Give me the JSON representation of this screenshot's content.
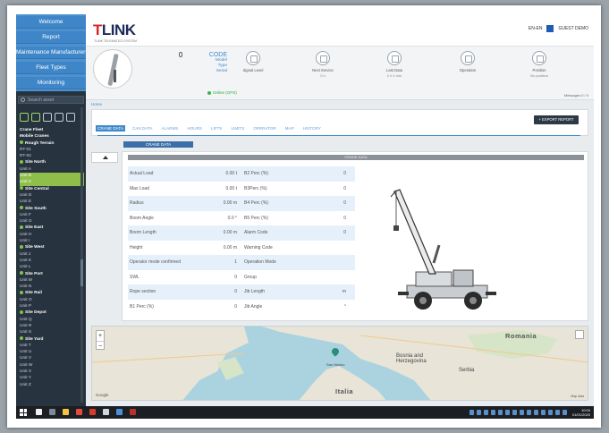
{
  "sidebar": {
    "nav": [
      "Welcome",
      "Report",
      "Maintenance Manufacturers",
      "Fleet Types",
      "Monitoring"
    ],
    "search_placeholder": "Search asset",
    "tree": [
      {
        "label": "Crane Fleet",
        "type": "grp"
      },
      {
        "label": "Mobile Cranes",
        "type": "grp"
      },
      {
        "label": "Rough Terrain",
        "type": "dot"
      },
      {
        "label": "RT-01",
        "type": "item"
      },
      {
        "label": "RT-02",
        "type": "item"
      },
      {
        "label": "Site North",
        "type": "dot"
      },
      {
        "label": "Unit A",
        "type": "item"
      },
      {
        "label": "Unit B",
        "type": "sel"
      },
      {
        "label": "Unit C",
        "type": "sel"
      },
      {
        "label": "Site Central",
        "type": "dot"
      },
      {
        "label": "Unit D",
        "type": "item"
      },
      {
        "label": "Unit E",
        "type": "item"
      },
      {
        "label": "Site South",
        "type": "dot"
      },
      {
        "label": "Unit F",
        "type": "item"
      },
      {
        "label": "Unit G",
        "type": "item"
      },
      {
        "label": "Site East",
        "type": "dot"
      },
      {
        "label": "Unit H",
        "type": "item"
      },
      {
        "label": "Unit I",
        "type": "item"
      },
      {
        "label": "Site West",
        "type": "dot"
      },
      {
        "label": "Unit J",
        "type": "item"
      },
      {
        "label": "Unit K",
        "type": "item"
      },
      {
        "label": "Unit L",
        "type": "item"
      },
      {
        "label": "Site Port",
        "type": "dot"
      },
      {
        "label": "Unit M",
        "type": "item"
      },
      {
        "label": "Unit N",
        "type": "item"
      },
      {
        "label": "Site Rail",
        "type": "dot"
      },
      {
        "label": "Unit O",
        "type": "item"
      },
      {
        "label": "Unit P",
        "type": "item"
      },
      {
        "label": "Site Depot",
        "type": "dot"
      },
      {
        "label": "Unit Q",
        "type": "item"
      },
      {
        "label": "Unit R",
        "type": "item"
      },
      {
        "label": "Unit S",
        "type": "item"
      },
      {
        "label": "Site Yard",
        "type": "dot"
      },
      {
        "label": "Unit T",
        "type": "item"
      },
      {
        "label": "Unit U",
        "type": "item"
      },
      {
        "label": "Unit V",
        "type": "item"
      },
      {
        "label": "Unit W",
        "type": "item"
      },
      {
        "label": "Unit X",
        "type": "item"
      },
      {
        "label": "Unit Y",
        "type": "item"
      },
      {
        "label": "Unit Z",
        "type": "item"
      }
    ]
  },
  "header": {
    "logo_t": "T",
    "logo_rest": "LINK",
    "logo_sub": "TLINK TELEMATICS SYSTEM",
    "user_lang": "EN-EN",
    "user_name": "GUEST DEMO"
  },
  "asset": {
    "code": "CODE",
    "lines": [
      "Model",
      "Type",
      "Serial"
    ],
    "status": "Online (GPS)"
  },
  "kpis": [
    {
      "label": "Signal Level",
      "value": ""
    },
    {
      "label": "Next Service",
      "value": "0 h"
    },
    {
      "label": "Last Data",
      "value": "0 h 0 min"
    },
    {
      "label": "Operation",
      "value": ""
    },
    {
      "label": "Position",
      "value": "No position"
    }
  ],
  "band_footer": "Messages 0 / 0",
  "content": {
    "breadcrumb": "Home",
    "tabs": [
      "CRANE DATA",
      "CAN DATA",
      "ALARMS",
      "HOURS",
      "LIFTS",
      "LIMITS",
      "OPERATOR",
      "MAP",
      "HISTORY"
    ],
    "export_button": "+ EXPORT REPORT",
    "title_pill": "CRANE DATA",
    "card_header": "CRANE DATA"
  },
  "grid_rows": [
    {
      "l1": "Actual Load",
      "v1": "0.00 t",
      "l2": "B2 Perc (%)",
      "v2": "0"
    },
    {
      "l1": "Max Load",
      "v1": "0.00 t",
      "l2": "B3Perc (%)",
      "v2": "0"
    },
    {
      "l1": "Radius",
      "v1": "0.00 m",
      "l2": "B4 Perc (%)",
      "v2": "0"
    },
    {
      "l1": "Boom Angle",
      "v1": "0.0 °",
      "l2": "B5 Perc (%)",
      "v2": "0"
    },
    {
      "l1": "Boom Length",
      "v1": "0.00 m",
      "l2": "Alarm Code",
      "v2": "0"
    },
    {
      "l1": "Height",
      "v1": "0.00 m",
      "l2": "Warning Code",
      "v2": ""
    },
    {
      "l1": "Operator mode confirmed",
      "v1": "1",
      "l2": "Operation Mode",
      "v2": ""
    },
    {
      "l1": "SWL",
      "v1": "0",
      "l2": "Group",
      "v2": ""
    },
    {
      "l1": "Rope section",
      "v1": "0",
      "l2": "Jib Length",
      "v2": "m"
    },
    {
      "l1": "B1 Perc (%)",
      "v1": "0",
      "l2": "Jib Angle",
      "v2": "°"
    }
  ],
  "map": {
    "zoom_in": "+",
    "zoom_out": "−",
    "labels": [
      "Romania",
      "Bosnia and Herzegovina",
      "Serbia",
      "Italia",
      "San Marino"
    ],
    "google": "Google",
    "attribution": "Map data"
  },
  "taskbar": {
    "time": "10:00",
    "date": "01/01/2020"
  },
  "colors": {
    "accent": "#3f8acb",
    "sidebar_bg": "#27333f",
    "nav_bg": "#4d92cf",
    "selected_green": "#8fbf4a"
  }
}
